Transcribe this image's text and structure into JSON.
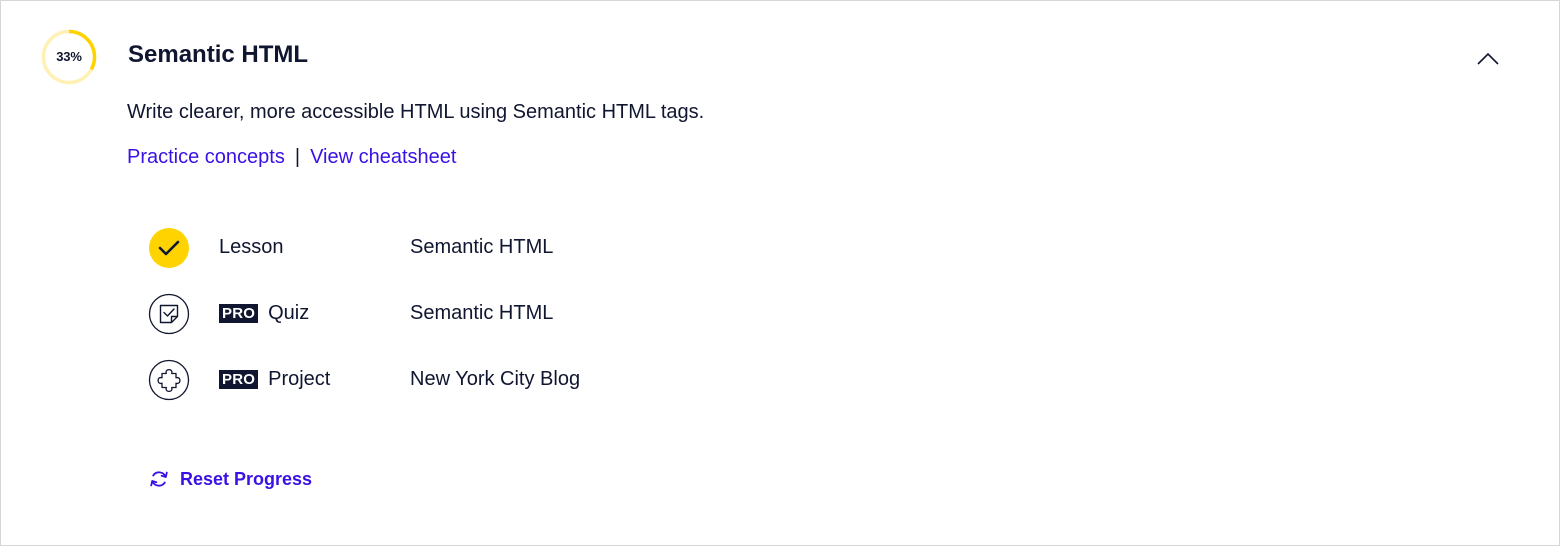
{
  "module": {
    "progress_label": "33%",
    "progress_fraction": 0.33,
    "title": "Semantic HTML",
    "description": "Write clearer, more accessible HTML using Semantic HTML tags.",
    "links": {
      "practice": "Practice concepts",
      "separator": "|",
      "cheatsheet": "View cheatsheet"
    },
    "items": [
      {
        "icon": "checkmark-icon",
        "completed": true,
        "pro": false,
        "type": "Lesson",
        "name": "Semantic HTML"
      },
      {
        "icon": "quiz-note-icon",
        "completed": false,
        "pro": true,
        "pro_label": "PRO",
        "type": "Quiz",
        "name": "Semantic HTML"
      },
      {
        "icon": "puzzle-icon",
        "completed": false,
        "pro": true,
        "pro_label": "PRO",
        "type": "Project",
        "name": "New York City Blog"
      }
    ],
    "reset_label": "Reset Progress"
  },
  "colors": {
    "text": "#10162f",
    "link": "#3a10e5",
    "progress": "#ffd300",
    "progress_track": "#fff0b3",
    "border": "#d6d6d6"
  }
}
